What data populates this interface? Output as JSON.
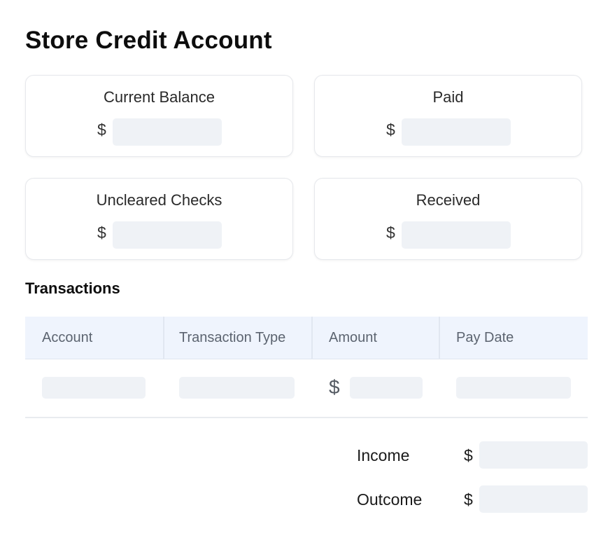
{
  "page": {
    "title": "Store Credit Account"
  },
  "cards": [
    {
      "label": "Current Balance",
      "currency": "$",
      "value": ""
    },
    {
      "label": "Paid",
      "currency": "$",
      "value": ""
    },
    {
      "label": "Uncleared Checks",
      "currency": "$",
      "value": ""
    },
    {
      "label": "Received",
      "currency": "$",
      "value": ""
    }
  ],
  "transactions": {
    "title": "Transactions",
    "columns": [
      "Account",
      "Transaction Type",
      "Amount",
      "Pay Date"
    ],
    "rows": [
      {
        "account": "",
        "type": "",
        "currency": "$",
        "amount": "",
        "pay_date": ""
      }
    ]
  },
  "totals": {
    "income": {
      "label": "Income",
      "currency": "$",
      "value": ""
    },
    "outcome": {
      "label": "Outcome",
      "currency": "$",
      "value": ""
    }
  },
  "colors": {
    "field_bg": "#eff2f6",
    "table_header_bg": "#eff4fd",
    "card_border": "#e6e8ec"
  }
}
